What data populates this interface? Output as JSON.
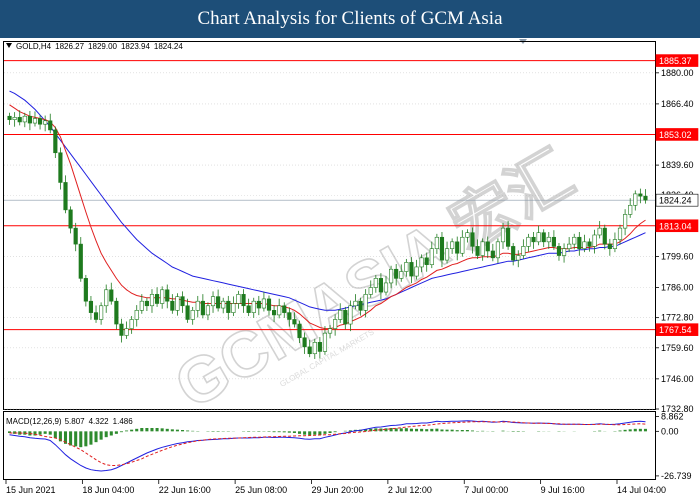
{
  "header": {
    "title": "Chart Analysis for Clients of GCM Asia"
  },
  "symbol_bar": {
    "symbol": "GOLD",
    "timeframe": ",H4",
    "open": "1826.27",
    "high": "1829.00",
    "low": "1823.94",
    "close": "1824.24"
  },
  "watermark": {
    "text": "GCMASIA 宏汇",
    "subtext": "GLOBAL CAPITAL MARKETS"
  },
  "colors": {
    "candle": "#1e7a1e",
    "resistance": "#ff0000",
    "ma_fast": "#e02020",
    "ma_slow": "#2020e0",
    "current_price": "#8899aa",
    "macd_hist": "#2e8b2e",
    "macd_main": "#2020e0",
    "macd_signal": "#e02020"
  },
  "chart_data": [
    {
      "type": "candlestick",
      "symbol": "GOLD",
      "timeframe": "H4",
      "ylim": [
        1732.8,
        1893.5
      ],
      "x_tick_labels": [
        "15 Jun 2021",
        "18 Jun 04:00",
        "22 Jun 16:00",
        "25 Jun 08:00",
        "29 Jun 20:00",
        "2 Jul 12:00",
        "7 Jul 00:00",
        "9 Jul 16:00",
        "14 Jul 04:00"
      ],
      "y_tick_labels": [
        "1880.00",
        "1866.40",
        "1853.02",
        "1839.60",
        "1826.40",
        "1813.04",
        "1799.60",
        "1786.00",
        "1772.80",
        "1767.54",
        "1759.60",
        "1746.00",
        "1732.80"
      ],
      "price_grid": [
        1880.0,
        1866.4,
        1839.6,
        1826.4,
        1799.6,
        1786.0,
        1772.8,
        1759.6,
        1746.0,
        1732.8
      ],
      "price_labels": [
        {
          "label": "1885.37",
          "value": 1885.37,
          "kind": "resistance"
        },
        {
          "label": "1853.02",
          "value": 1853.02,
          "kind": "resistance"
        },
        {
          "label": "1813.04",
          "value": 1813.04,
          "kind": "resistance"
        },
        {
          "label": "1767.54",
          "value": 1767.54,
          "kind": "resistance"
        },
        {
          "label": "1824.24",
          "value": 1824.24,
          "kind": "current"
        }
      ],
      "closes": [
        1859.5,
        1860.5,
        1858.5,
        1861.0,
        1858.0,
        1860.0,
        1857.5,
        1859.0,
        1855.0,
        1845.0,
        1832.0,
        1820.0,
        1812.0,
        1805.0,
        1790.0,
        1780.0,
        1775.0,
        1772.0,
        1778.0,
        1785.0,
        1780.0,
        1770.0,
        1765.0,
        1768.0,
        1772.0,
        1776.0,
        1780.0,
        1778.0,
        1783.0,
        1779.0,
        1785.0,
        1780.0,
        1776.0,
        1782.0,
        1778.0,
        1772.0,
        1776.0,
        1780.0,
        1774.0,
        1778.0,
        1782.0,
        1777.0,
        1780.0,
        1775.0,
        1779.0,
        1783.0,
        1778.0,
        1775.0,
        1780.0,
        1777.0,
        1781.0,
        1776.0,
        1774.0,
        1778.0,
        1775.0,
        1772.0,
        1770.0,
        1764.0,
        1760.0,
        1757.0,
        1762.0,
        1758.0,
        1766.0,
        1768.0,
        1772.0,
        1776.0,
        1770.0,
        1778.0,
        1780.0,
        1776.0,
        1783.0,
        1786.0,
        1790.0,
        1784.0,
        1788.0,
        1794.0,
        1790.0,
        1793.0,
        1797.0,
        1791.0,
        1795.0,
        1799.0,
        1796.0,
        1803.0,
        1808.0,
        1798.0,
        1803.0,
        1806.0,
        1801.0,
        1808.0,
        1810.0,
        1804.0,
        1800.0,
        1806.0,
        1802.0,
        1799.0,
        1806.0,
        1812.0,
        1804.0,
        1798.0,
        1800.0,
        1804.0,
        1808.0,
        1806.0,
        1810.0,
        1806.0,
        1808.0,
        1804.0,
        1800.0,
        1803.0,
        1805.0,
        1808.0,
        1803.0,
        1806.0,
        1804.0,
        1809.0,
        1812.0,
        1805.0,
        1803.0,
        1807.0,
        1812.0,
        1818.0,
        1822.0,
        1827.0,
        1826.0,
        1824.24
      ],
      "series": [
        {
          "values": [
            1872.0,
            1871.0,
            1869.5,
            1868.0,
            1866.0,
            1864.0,
            1861.5,
            1859.0,
            1856.5,
            1853.5,
            1850.5,
            1847.5,
            1844.5,
            1841.5,
            1838.5,
            1835.5,
            1832.5,
            1829.5,
            1826.5,
            1823.5,
            1820.5,
            1817.5,
            1814.5,
            1812.0,
            1809.5,
            1807.0,
            1805.0,
            1803.0,
            1801.0,
            1799.5,
            1798.0,
            1796.5,
            1795.0,
            1794.0,
            1793.0,
            1792.0,
            1791.0,
            1790.5,
            1790.0,
            1789.5,
            1789.0,
            1788.5,
            1788.0,
            1787.5,
            1787.0,
            1786.5,
            1786.0,
            1785.5,
            1785.0,
            1784.5,
            1784.0,
            1783.5,
            1783.0,
            1782.5,
            1782.0,
            1781.5,
            1780.5,
            1779.5,
            1778.5,
            1777.5,
            1777.0,
            1776.5,
            1776.0,
            1776.0,
            1776.0,
            1776.5,
            1777.0,
            1777.5,
            1778.0,
            1778.5,
            1779.0,
            1779.5,
            1780.0,
            1780.5,
            1781.0,
            1782.0,
            1783.0,
            1784.0,
            1785.0,
            1786.0,
            1787.0,
            1788.0,
            1789.0,
            1790.0,
            1790.5,
            1791.0,
            1791.5,
            1792.0,
            1792.5,
            1793.0,
            1793.5,
            1794.0,
            1794.5,
            1795.0,
            1795.5,
            1796.0,
            1796.5,
            1797.0,
            1797.5,
            1797.5,
            1798.0,
            1798.5,
            1799.0,
            1799.5,
            1800.0,
            1800.5,
            1801.0,
            1801.0,
            1801.0,
            1801.5,
            1802.0,
            1802.0,
            1802.5,
            1802.5,
            1803.0,
            1803.0,
            1803.5,
            1803.5,
            1804.0,
            1804.0,
            1805.0,
            1806.0,
            1807.0,
            1808.0,
            1809.0,
            1810.0
          ]
        },
        {
          "values": [
            1866.0,
            1864.5,
            1863.0,
            1862.0,
            1861.0,
            1860.5,
            1860.0,
            1859.5,
            1858.5,
            1856.0,
            1852.0,
            1846.0,
            1840.0,
            1833.0,
            1826.0,
            1819.0,
            1812.5,
            1806.5,
            1801.0,
            1797.0,
            1793.5,
            1790.0,
            1787.0,
            1785.0,
            1783.5,
            1782.5,
            1782.0,
            1781.5,
            1781.5,
            1781.5,
            1781.5,
            1781.5,
            1781.0,
            1781.0,
            1780.5,
            1780.0,
            1779.5,
            1779.5,
            1779.0,
            1779.0,
            1779.0,
            1779.0,
            1779.0,
            1779.0,
            1779.0,
            1779.0,
            1779.0,
            1779.0,
            1779.0,
            1779.0,
            1779.0,
            1778.5,
            1778.0,
            1778.0,
            1777.5,
            1777.0,
            1776.0,
            1774.5,
            1772.5,
            1770.5,
            1769.5,
            1768.5,
            1768.0,
            1768.0,
            1768.5,
            1769.5,
            1770.0,
            1771.0,
            1772.0,
            1773.0,
            1774.5,
            1776.0,
            1778.0,
            1779.0,
            1780.5,
            1782.0,
            1783.0,
            1784.5,
            1786.0,
            1787.0,
            1788.0,
            1789.5,
            1790.5,
            1792.0,
            1793.5,
            1794.0,
            1795.0,
            1796.0,
            1796.5,
            1797.5,
            1798.5,
            1799.0,
            1799.0,
            1799.5,
            1799.5,
            1799.5,
            1800.0,
            1801.0,
            1801.0,
            1800.5,
            1800.5,
            1801.0,
            1801.5,
            1802.0,
            1802.5,
            1803.0,
            1803.5,
            1803.5,
            1803.0,
            1803.0,
            1803.0,
            1803.5,
            1803.5,
            1803.5,
            1803.5,
            1804.0,
            1805.0,
            1805.0,
            1805.0,
            1805.0,
            1806.0,
            1807.5,
            1809.5,
            1812.0,
            1814.0,
            1815.5
          ]
        }
      ]
    },
    {
      "type": "bar",
      "title": "MACD(12,26,9) 5.807 4.322 1.486",
      "indicator": "MACD(12,26,9)",
      "values_readout": [
        "5.807",
        "4.322",
        "1.486"
      ],
      "y_tick_labels": [
        "8.862",
        "0.00",
        "-26.739"
      ],
      "ylim": [
        -28.0,
        11.0
      ],
      "values": [
        -1.0,
        -1.5,
        -2.0,
        -2.0,
        -2.5,
        -2.5,
        -2.0,
        -1.5,
        -2.0,
        -4.0,
        -6.0,
        -7.5,
        -8.5,
        -9.0,
        -9.5,
        -9.0,
        -8.0,
        -6.5,
        -5.0,
        -3.5,
        -2.5,
        -1.5,
        -0.5,
        0.5,
        1.0,
        1.5,
        2.0,
        2.0,
        2.0,
        2.0,
        1.8,
        1.5,
        1.2,
        1.0,
        0.8,
        0.5,
        0.3,
        0.2,
        0.0,
        -0.2,
        -0.3,
        -0.3,
        -0.2,
        -0.2,
        -0.1,
        0.0,
        -0.2,
        -0.3,
        -0.2,
        -0.3,
        -0.2,
        -0.3,
        -0.5,
        -0.5,
        -0.6,
        -0.8,
        -1.0,
        -1.5,
        -2.0,
        -2.3,
        -2.0,
        -2.2,
        -1.5,
        -1.0,
        -0.5,
        0.0,
        0.3,
        0.6,
        0.9,
        1.0,
        1.3,
        1.5,
        1.8,
        1.7,
        1.8,
        2.0,
        1.8,
        1.8,
        1.9,
        1.6,
        1.5,
        1.5,
        1.3,
        1.5,
        1.6,
        1.1,
        1.0,
        1.0,
        0.7,
        0.8,
        0.8,
        0.5,
        0.2,
        0.3,
        0.1,
        -0.2,
        0.0,
        0.4,
        0.1,
        -0.3,
        -0.3,
        -0.2,
        0.0,
        0.0,
        0.2,
        0.1,
        0.1,
        0.0,
        -0.2,
        -0.1,
        0.0,
        0.1,
        0.0,
        0.0,
        0.0,
        0.2,
        0.4,
        0.1,
        0.0,
        0.2,
        0.5,
        0.9,
        1.2,
        1.5,
        1.5,
        1.486
      ],
      "series": [
        {
          "values": [
            -2.0,
            -2.5,
            -3.0,
            -3.2,
            -3.8,
            -4.2,
            -4.4,
            -4.6,
            -5.5,
            -8.0,
            -11.0,
            -14.0,
            -16.5,
            -18.5,
            -20.5,
            -22.0,
            -23.0,
            -23.5,
            -23.8,
            -23.5,
            -23.0,
            -22.0,
            -20.5,
            -19.0,
            -17.5,
            -16.0,
            -14.5,
            -13.0,
            -11.8,
            -10.6,
            -9.6,
            -8.8,
            -8.0,
            -7.3,
            -6.8,
            -6.3,
            -5.9,
            -5.5,
            -5.3,
            -5.1,
            -4.9,
            -4.7,
            -4.5,
            -4.4,
            -4.2,
            -4.0,
            -4.0,
            -4.0,
            -3.8,
            -3.8,
            -3.6,
            -3.6,
            -3.7,
            -3.6,
            -3.6,
            -3.7,
            -3.8,
            -4.2,
            -4.6,
            -4.8,
            -4.4,
            -4.4,
            -3.6,
            -3.0,
            -2.2,
            -1.5,
            -1.0,
            -0.3,
            0.3,
            0.6,
            1.2,
            1.8,
            2.5,
            2.6,
            3.0,
            3.5,
            3.6,
            4.0,
            4.5,
            4.5,
            4.7,
            5.0,
            5.0,
            5.5,
            6.0,
            5.8,
            5.9,
            6.1,
            6.0,
            6.2,
            6.4,
            6.2,
            5.9,
            6.0,
            5.8,
            5.5,
            5.6,
            6.0,
            5.8,
            5.3,
            5.1,
            5.0,
            5.0,
            4.9,
            5.0,
            4.9,
            4.8,
            4.6,
            4.3,
            4.2,
            4.2,
            4.3,
            4.2,
            4.1,
            4.1,
            4.3,
            4.6,
            4.3,
            4.1,
            4.2,
            4.5,
            5.0,
            5.5,
            5.9,
            6.0,
            5.807
          ]
        },
        {
          "values": [
            -1.0,
            -1.0,
            -1.0,
            -1.2,
            -1.3,
            -1.7,
            -2.4,
            -3.1,
            -3.5,
            -4.0,
            -5.0,
            -6.5,
            -8.0,
            -9.5,
            -11.0,
            -13.0,
            -15.0,
            -17.0,
            -18.8,
            -20.0,
            -20.5,
            -20.5,
            -20.0,
            -19.5,
            -18.5,
            -17.5,
            -16.5,
            -15.0,
            -13.8,
            -12.6,
            -11.4,
            -10.3,
            -9.2,
            -8.3,
            -7.6,
            -6.8,
            -6.2,
            -5.7,
            -5.3,
            -4.9,
            -4.6,
            -4.4,
            -4.3,
            -4.2,
            -4.1,
            -4.0,
            -3.8,
            -3.7,
            -3.6,
            -3.5,
            -3.4,
            -3.3,
            -3.2,
            -3.1,
            -3.0,
            -2.9,
            -2.8,
            -2.7,
            -2.6,
            -2.5,
            -2.4,
            -2.2,
            -2.1,
            -2.0,
            -1.7,
            -1.5,
            -1.3,
            -0.9,
            -0.6,
            -0.4,
            -0.1,
            0.3,
            0.7,
            0.9,
            1.2,
            1.5,
            1.8,
            2.2,
            2.6,
            2.9,
            3.2,
            3.5,
            3.7,
            4.0,
            4.4,
            4.7,
            4.9,
            5.1,
            5.3,
            5.4,
            5.6,
            5.7,
            5.7,
            5.7,
            5.7,
            5.7,
            5.6,
            5.6,
            5.7,
            5.6,
            5.4,
            5.2,
            5.0,
            4.9,
            4.8,
            4.8,
            4.7,
            4.6,
            4.5,
            4.3,
            4.2,
            4.2,
            4.2,
            4.1,
            4.1,
            4.1,
            4.2,
            4.2,
            4.1,
            4.0,
            4.0,
            4.1,
            4.3,
            4.4,
            4.5,
            4.322
          ]
        }
      ]
    }
  ]
}
